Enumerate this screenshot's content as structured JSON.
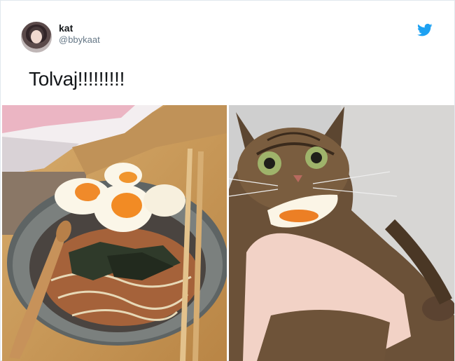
{
  "tweet": {
    "author_name": "kat",
    "author_handle": "@bbykaat",
    "text": "Tolvaj!!!!!!!!!",
    "brand_color": "#1da1f2"
  },
  "media": [
    {
      "icon": "photo-ramen-bowl-with-eggs"
    },
    {
      "icon": "photo-cat-holding-egg"
    }
  ]
}
